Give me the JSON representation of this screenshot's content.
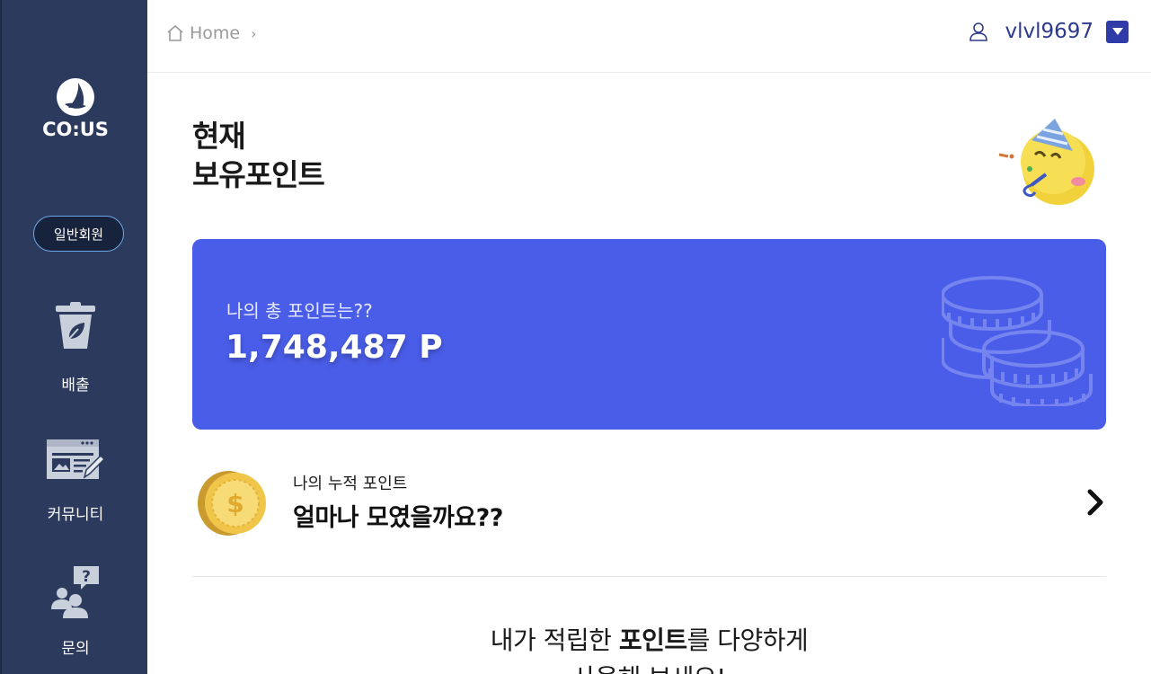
{
  "sidebar": {
    "logo_text": "CO:US",
    "member_badge": "일반회원",
    "items": [
      {
        "label": "배출",
        "icon": "trash-leaf-icon"
      },
      {
        "label": "커뮤니티",
        "icon": "web-edit-icon"
      },
      {
        "label": "문의",
        "icon": "question-users-icon"
      }
    ]
  },
  "header": {
    "breadcrumb": {
      "home": "Home",
      "separator": "›"
    },
    "username": "vlvl9697"
  },
  "main": {
    "title_line1": "현재",
    "title_line2": "보유포인트",
    "card": {
      "caption": "나의 총 포인트는??",
      "value": "1,748,487 P"
    },
    "accumulated": {
      "subtitle": "나의 누적 포인트",
      "title": "얼마나 모였을까요??"
    },
    "promo": {
      "line1_pre": "내가 적립한 ",
      "line1_bold": "포인트",
      "line1_post": "를 다양하게",
      "line2": "사용해 보세요!"
    }
  },
  "colors": {
    "sidebar_bg": "#2c3a5e",
    "card_bg": "#4a5de8",
    "accent": "#2f3ba8"
  }
}
